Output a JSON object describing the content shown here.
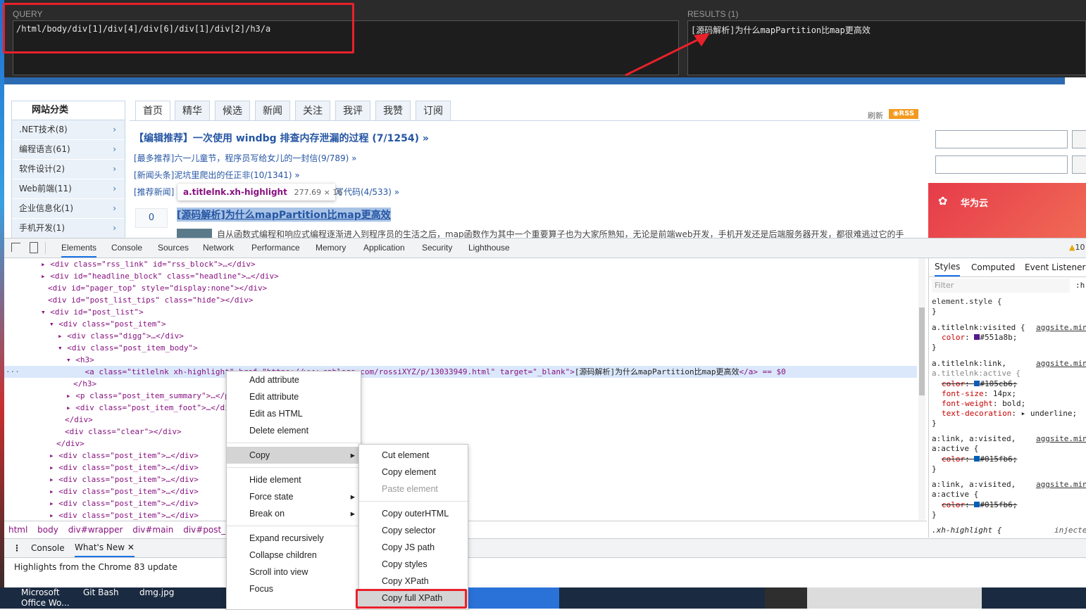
{
  "xpath_helper": {
    "query_label": "QUERY",
    "query_value": "/html/body/div[1]/div[4]/div[6]/div[1]/div[2]/h3/a",
    "results_label": "RESULTS (1)",
    "result_value": "[源码解析]为什么mapPartition比map更高效"
  },
  "blog": {
    "sidebar_title": "网站分类",
    "categories": [
      ".NET技术(8)",
      "编程语言(61)",
      "软件设计(2)",
      "Web前端(11)",
      "企业信息化(1)",
      "手机开发(1)"
    ],
    "tabs": [
      "首页",
      "精华",
      "候选",
      "新闻",
      "关注",
      "我评",
      "我赞",
      "订阅"
    ],
    "refresh_label": "刷新",
    "rss_label": "RSS",
    "headline": "【编辑推荐】一次使用 windbg 排查内存泄漏的过程 (7/1254) »",
    "news": [
      "[最多推荐]六一儿童节，程序员写给女儿的一封信(9/789) »",
      "[新闻头条]泥坑里爬出的任正非(10/1341) »",
      "写代码(4/533) »"
    ],
    "news_prefix": "[推荐新闻]",
    "tooltip_selector": "a.titlelnk.xh-highlight",
    "tooltip_size": "277.69 × 16",
    "digg_count": "0",
    "post_title": "[源码解析]为什么mapPartition比map更高效",
    "post_summary": "自从函数式编程和响应式编程逐渐进入到程序员的生活之后，map函数作为其中一个重要算子也为大家所熟知，无论是前端web开发，手机开发还是后端服务器开发，都很难逃过它的手",
    "ad_brand": "华为云"
  },
  "devtools": {
    "tabs": [
      "Elements",
      "Console",
      "Sources",
      "Network",
      "Performance",
      "Memory",
      "Application",
      "Security",
      "Lighthouse"
    ],
    "warning_count": "10",
    "tree": [
      "<div class=\"rss_link\" id=\"rss_block\">…</div>",
      "<div id=\"headline_block\" class=\"headline\">…</div>",
      "<div id=\"pager_top\" style=\"display:none\"></div>",
      "<div id=\"post_list_tips\" class=\"hide\"></div>",
      "<div id=\"post_list\">",
      "<div class=\"post_item\">",
      "<div class=\"digg\">…</div>",
      "<div class=\"post_item_body\">",
      "<h3>",
      "<a class=\"titlelnk xh-highlight\" href=\"https://www.cnblogs.com/rossiXYZ/p/13033949.html\" target=\"_blank\">",
      "</h3>",
      "<p class=\"post_item_summary\">…</p>",
      "<div class=\"post_item_foot\">…</div>",
      "</div>",
      "<div class=\"clear\"></div>",
      "</div>",
      "<div class=\"post_item\">…</div>"
    ],
    "selected_text": "[源码解析]为什么mapPartition比map更高效",
    "selected_suffix": "</a> == $0",
    "breadcrumb": [
      "html",
      "body",
      "div#wrapper",
      "div#main",
      "div#post_list"
    ],
    "styles_tabs": [
      "Styles",
      "Computed",
      "Event Listeners"
    ],
    "filter_placeholder": "Filter",
    "filter_suffix": ":h",
    "styles": {
      "element_style": "element.style {",
      "visited_rule": "a.titlelnk:visited {",
      "visited_color": "#551a8b;",
      "link_rule_1": "a.titlelnk:link,",
      "link_rule_2": "a.titlelnk:active {",
      "link_color": "#105cb6;",
      "font_size": "14px;",
      "font_weight": "bold;",
      "text_decoration": "underline;",
      "generic_rule_1": "a:link, a:visited,",
      "generic_rule_2": "a:active {",
      "generic_color": "#015fb6;",
      "source": "aggsite.min",
      "highlight_rule": ".xh-highlight {",
      "injected": "injecte"
    },
    "drawer_tabs": [
      "Console",
      "What's New"
    ],
    "drawer_text": "Highlights from the Chrome 83 update"
  },
  "context_menu": {
    "items": [
      "Add attribute",
      "Edit attribute",
      "Edit as HTML",
      "Delete element",
      "Copy",
      "Hide element",
      "Force state",
      "Break on",
      "Expand recursively",
      "Collapse children",
      "Scroll into view",
      "Focus"
    ]
  },
  "copy_submenu": {
    "items": [
      "Cut element",
      "Copy element",
      "Paste element",
      "Copy outerHTML",
      "Copy selector",
      "Copy JS path",
      "Copy styles",
      "Copy XPath",
      "Copy full XPath"
    ]
  },
  "taskbar": {
    "items": [
      "Microsoft Office Wo...",
      "Git Bash",
      "dmg.jpg"
    ]
  },
  "colors": {
    "accent": "#1a73e8",
    "annotation_red": "#e8212b",
    "tag": "#881280",
    "attr": "#994500",
    "value": "#1a1aa6"
  }
}
